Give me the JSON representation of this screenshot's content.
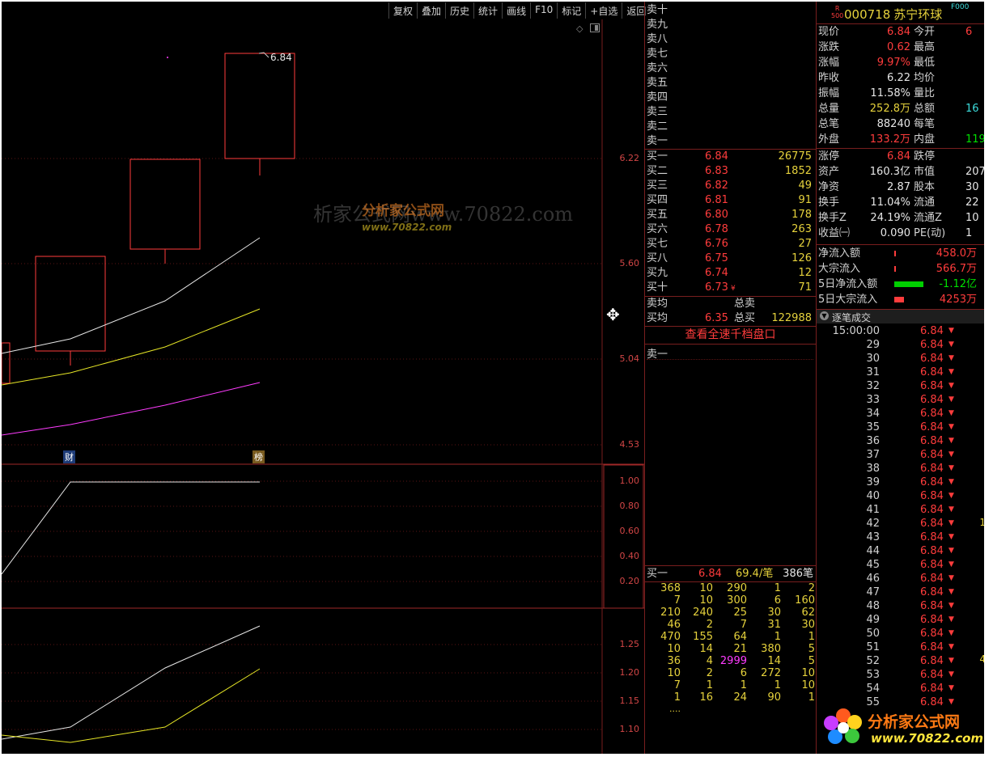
{
  "toolbar": [
    "复权",
    "叠加",
    "历史",
    "统计",
    "画线",
    "F10",
    "标记",
    "+自选",
    "返回"
  ],
  "chart": {
    "last_price_label": "6.84",
    "main_axis": [
      "6.22",
      "5.60",
      "5.04",
      "4.53"
    ],
    "sub1_axis": [
      "1.00",
      "0.80",
      "0.60",
      "0.40",
      "0.20"
    ],
    "sub2_axis": [
      "1.25",
      "1.20",
      "1.15",
      "1.10"
    ],
    "marker_cai": "财",
    "marker_bang": "榜",
    "watermark_text": "分析家公式网",
    "watermark_url": "www.70822.com",
    "watermark_long": "析家公式网www.70822.com"
  },
  "orderbook": {
    "sell": [
      "卖十",
      "卖九",
      "卖八",
      "卖七",
      "卖六",
      "卖五",
      "卖四",
      "卖三",
      "卖二",
      "卖一"
    ],
    "buy": [
      {
        "label": "买一",
        "price": "6.84",
        "vol": "26775"
      },
      {
        "label": "买二",
        "price": "6.83",
        "vol": "1852"
      },
      {
        "label": "买三",
        "price": "6.82",
        "vol": "49"
      },
      {
        "label": "买四",
        "price": "6.81",
        "vol": "91"
      },
      {
        "label": "买五",
        "price": "6.80",
        "vol": "178"
      },
      {
        "label": "买六",
        "price": "6.78",
        "vol": "263"
      },
      {
        "label": "买七",
        "price": "6.76",
        "vol": "27"
      },
      {
        "label": "买八",
        "price": "6.75",
        "vol": "126"
      },
      {
        "label": "买九",
        "price": "6.74",
        "vol": "12"
      },
      {
        "label": "买十",
        "price": "6.73",
        "vol": "71",
        "mark": "¥"
      }
    ],
    "sell_avg_label": "卖均",
    "sell_total_label": "总卖",
    "buy_avg_label": "买均",
    "buy_avg": "6.35",
    "buy_total_label": "总买",
    "buy_total": "122988",
    "full_depth_button": "查看全速千档盘口",
    "queue_sell_label": "卖一",
    "queue_buy": {
      "label": "买一",
      "price": "6.84",
      "avg": "69.4/笔",
      "count": "386笔"
    },
    "queue_rows": [
      [
        "368",
        "10",
        "290",
        "1",
        "2"
      ],
      [
        "7",
        "10",
        "300",
        "6",
        "160"
      ],
      [
        "210",
        "240",
        "25",
        "30",
        "62"
      ],
      [
        "46",
        "2",
        "7",
        "31",
        "30"
      ],
      [
        "470",
        "155",
        "64",
        "1",
        "1"
      ],
      [
        "10",
        "14",
        "21",
        "380",
        "5"
      ],
      [
        "36",
        "4",
        "2999",
        "14",
        "5"
      ],
      [
        "10",
        "2",
        "6",
        "272",
        "10"
      ],
      [
        "7",
        "1",
        "1",
        "1",
        "10"
      ],
      [
        "1",
        "16",
        "24",
        "90",
        "1"
      ]
    ],
    "queue_more": "....",
    "highlight_value": "2999"
  },
  "quote": {
    "badge_r": "R",
    "badge_500": "500",
    "code": "000718",
    "name": "苏宁环球",
    "tag": "F000",
    "rows": [
      {
        "l1": "现价",
        "v1": "6.84",
        "c1": "red",
        "l2": "今开",
        "v2": "6",
        "c2": "red"
      },
      {
        "l1": "涨跌",
        "v1": "0.62",
        "c1": "red",
        "l2": "最高",
        "v2": "",
        "c2": "red"
      },
      {
        "l1": "涨幅",
        "v1": "9.97%",
        "c1": "red",
        "l2": "最低",
        "v2": "",
        "c2": "red"
      },
      {
        "l1": "昨收",
        "v1": "6.22",
        "c1": "wht",
        "l2": "均价",
        "v2": "",
        "c2": "red"
      },
      {
        "l1": "振幅",
        "v1": "11.58%",
        "c1": "wht",
        "l2": "量比",
        "v2": "",
        "c2": "wht"
      },
      {
        "l1": "总量",
        "v1": "252.8万",
        "c1": "yel",
        "l2": "总额",
        "v2": "16",
        "c2": "cyan"
      },
      {
        "l1": "总笔",
        "v1": "88240",
        "c1": "wht",
        "l2": "每笔",
        "v2": "",
        "c2": "wht"
      },
      {
        "l1": "外盘",
        "v1": "133.2万",
        "c1": "red",
        "l2": "内盘",
        "v2": "119",
        "c2": "grn"
      },
      {
        "l1": "涨停",
        "v1": "6.84",
        "c1": "red",
        "l2": "跌停",
        "v2": "",
        "c2": "grn"
      },
      {
        "l1": "资产",
        "v1": "160.3亿",
        "c1": "wht",
        "l2": "市值",
        "v2": "207",
        "c2": "wht"
      },
      {
        "l1": "净资",
        "v1": "2.87",
        "c1": "wht",
        "l2": "股本",
        "v2": "30",
        "c2": "wht"
      },
      {
        "l1": "换手",
        "v1": "11.04%",
        "c1": "wht",
        "l2": "流通",
        "v2": "22",
        "c2": "wht"
      },
      {
        "l1": "换手Z",
        "v1": "24.19%",
        "c1": "wht",
        "l2": "流通Z",
        "v2": "10",
        "c2": "wht"
      },
      {
        "l1": "收益㈠",
        "v1": "0.090",
        "c1": "wht",
        "l2": "PE(动)",
        "v2": "1",
        "c2": "wht"
      }
    ],
    "flows": [
      {
        "label": "净流入额",
        "value": "458.0万",
        "color": "red",
        "bar": "#ff3c3c",
        "barw": 2
      },
      {
        "label": "大宗流入",
        "value": "566.7万",
        "color": "red",
        "bar": "#ff3c3c",
        "barw": 2
      },
      {
        "label": "5日净流入额",
        "value": "-1.12亿",
        "color": "grn",
        "bar": "#00d000",
        "barw": 36
      },
      {
        "label": "5日大宗流入",
        "value": "4253万",
        "color": "red",
        "bar": "#ff3c3c",
        "barw": 12
      }
    ],
    "ticks_title": "逐笔成交",
    "ticks": [
      {
        "t": "15:00:00",
        "p": "6.84"
      },
      {
        "t": "29",
        "p": "6.84"
      },
      {
        "t": "30",
        "p": "6.84"
      },
      {
        "t": "31",
        "p": "6.84"
      },
      {
        "t": "32",
        "p": "6.84"
      },
      {
        "t": "33",
        "p": "6.84"
      },
      {
        "t": "34",
        "p": "6.84"
      },
      {
        "t": "35",
        "p": "6.84"
      },
      {
        "t": "36",
        "p": "6.84"
      },
      {
        "t": "37",
        "p": "6.84"
      },
      {
        "t": "38",
        "p": "6.84"
      },
      {
        "t": "39",
        "p": "6.84"
      },
      {
        "t": "40",
        "p": "6.84"
      },
      {
        "t": "41",
        "p": "6.84"
      },
      {
        "t": "42",
        "p": "6.84"
      },
      {
        "t": "43",
        "p": "6.84"
      },
      {
        "t": "44",
        "p": "6.84"
      },
      {
        "t": "45",
        "p": "6.84"
      },
      {
        "t": "46",
        "p": "6.84"
      },
      {
        "t": "47",
        "p": "6.84"
      },
      {
        "t": "48",
        "p": "6.84"
      },
      {
        "t": "49",
        "p": "6.84"
      },
      {
        "t": "50",
        "p": "6.84"
      },
      {
        "t": "51",
        "p": "6.84"
      },
      {
        "t": "52",
        "p": "6.84"
      },
      {
        "t": "53",
        "p": "6.84"
      },
      {
        "t": "54",
        "p": "6.84"
      },
      {
        "t": "55",
        "p": "6.84"
      }
    ],
    "tick_arrow": "▼",
    "tick_side_1": "1",
    "tick_side_2": "4"
  },
  "logo": {
    "text": "分析家公式网",
    "url": "www.70822.com"
  }
}
